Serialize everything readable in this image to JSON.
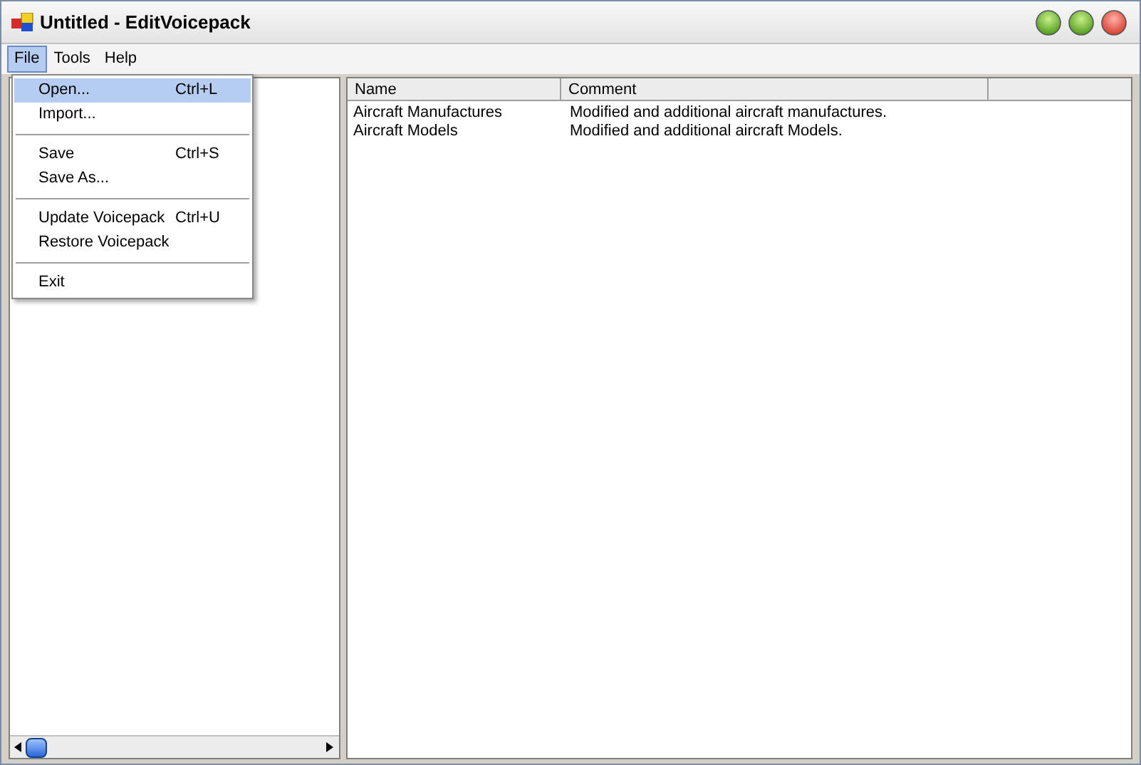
{
  "window": {
    "title": "Untitled - EditVoicepack"
  },
  "menu_bar": [
    {
      "label": "File",
      "selected": true
    },
    {
      "label": "Tools",
      "selected": false
    },
    {
      "label": "Help",
      "selected": false
    }
  ],
  "file_menu": [
    {
      "kind": "item",
      "label": "Open...",
      "shortcut": "Ctrl+L",
      "selected": true
    },
    {
      "kind": "item",
      "label": "Import...",
      "selected": false
    },
    {
      "kind": "separator"
    },
    {
      "kind": "item",
      "label": "Save",
      "shortcut": "Ctrl+S",
      "selected": false
    },
    {
      "kind": "item",
      "label": "Save As...",
      "selected": false
    },
    {
      "kind": "separator"
    },
    {
      "kind": "item",
      "label": "Update Voicepack",
      "shortcut": "Ctrl+U",
      "selected": false
    },
    {
      "kind": "item",
      "label": "Restore Voicepack",
      "selected": false
    },
    {
      "kind": "separator"
    },
    {
      "kind": "item",
      "label": "Exit",
      "selected": false
    }
  ],
  "table": {
    "columns": [
      "Name",
      "Comment"
    ],
    "rows": [
      [
        "Aircraft Manufactures",
        "Modified and additional aircraft manufactures."
      ],
      [
        "Aircraft Models",
        "Modified and additional aircraft Models."
      ]
    ]
  }
}
